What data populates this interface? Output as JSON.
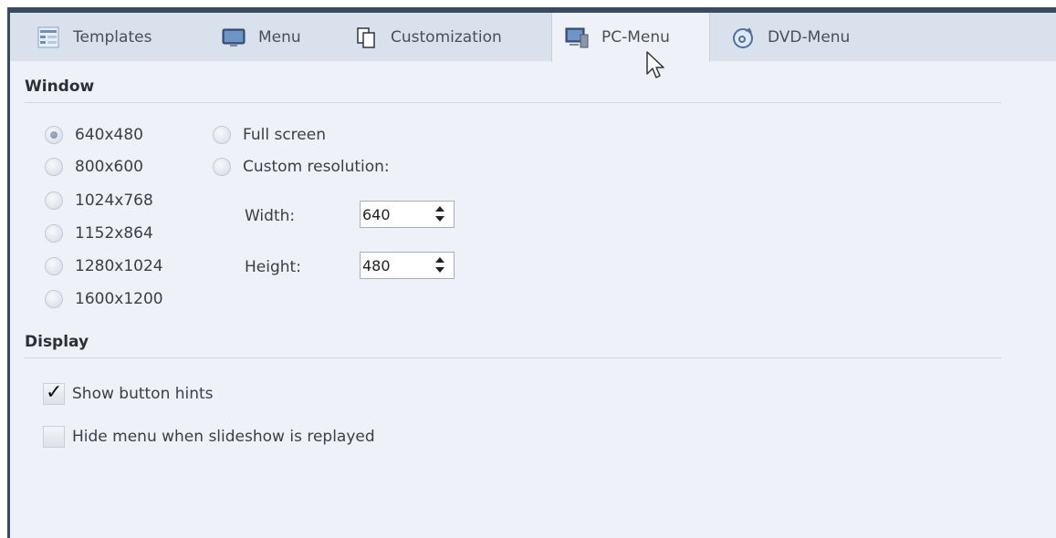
{
  "tabs": [
    {
      "label": "Templates",
      "icon": "templates-icon"
    },
    {
      "label": "Menu",
      "icon": "menu-icon"
    },
    {
      "label": "Customization",
      "icon": "customization-icon"
    },
    {
      "label": "PC-Menu",
      "icon": "pc-menu-icon",
      "active": true
    },
    {
      "label": "DVD-Menu",
      "icon": "dvd-menu-icon"
    }
  ],
  "window": {
    "title": "Window",
    "resolutions": [
      "640x480",
      "800x600",
      "1024x768",
      "1152x864",
      "1280x1024",
      "1600x1200"
    ],
    "selected_resolution": "640x480",
    "full_screen_label": "Full screen",
    "custom_resolution_label": "Custom resolution:",
    "width_label": "Width:",
    "width_value": "640",
    "height_label": "Height:",
    "height_value": "480"
  },
  "display": {
    "title": "Display",
    "show_button_hints_label": "Show button hints",
    "show_button_hints_checked": true,
    "hide_menu_label": "Hide menu when slideshow is replayed",
    "hide_menu_checked": false
  },
  "colors": {
    "panel_bg": "#eef1f7",
    "tabstrip_bg": "#d9e1ec",
    "frame_dark": "#3a4a63"
  }
}
